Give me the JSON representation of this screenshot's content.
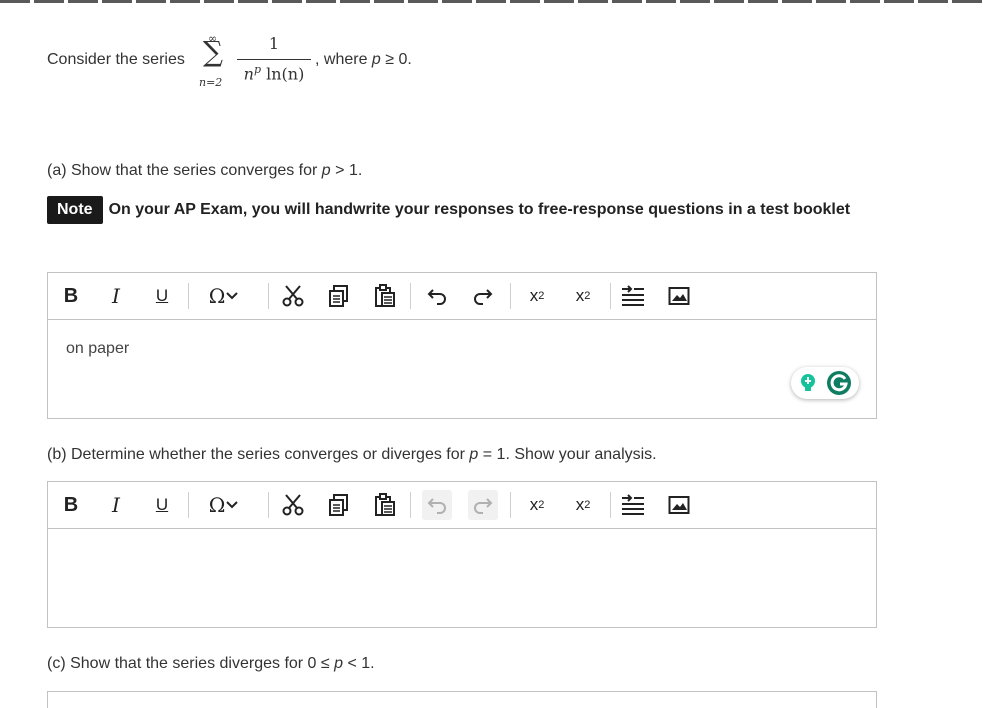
{
  "intro": {
    "lead": "Consider the series",
    "sum_upper": "∞",
    "sum_symbol": "∑",
    "sum_lower": "n=2",
    "numerator": "1",
    "denominator_np": "n",
    "denominator_p": "p",
    "denominator_ln": " ln(n)",
    "comma": ",",
    "where": " where ",
    "condition_var": "p",
    "condition_rest": " ≥ 0."
  },
  "part_a": {
    "text_pre": "(a) Show that the series converges for ",
    "var": "p",
    "text_post": " > 1."
  },
  "note": {
    "badge": "Note",
    "text": "On your AP Exam, you will handwrite your responses to free-response questions in a test booklet"
  },
  "editor_a": {
    "content": "on paper"
  },
  "part_b": {
    "text_pre": "(b) Determine whether the series converges or diverges for ",
    "var": "p",
    "text_post": " = 1. Show your analysis."
  },
  "editor_b": {
    "content": ""
  },
  "part_c": {
    "text_pre": "(c) Show that the series diverges for 0 ≤ ",
    "var": "p",
    "text_post": " < 1."
  },
  "toolbar": {
    "bold": "B",
    "italic": "I",
    "underline": "U",
    "omega": "Ω",
    "chevron": "⌄",
    "superscript_base": "x",
    "superscript_exp": "2",
    "subscript_base": "x",
    "subscript_exp": "2"
  },
  "icons": [
    "bold-icon",
    "italic-icon",
    "underline-icon",
    "special-characters-icon",
    "cut-icon",
    "copy-icon",
    "paste-icon",
    "undo-icon",
    "redo-icon",
    "superscript-icon",
    "subscript-icon",
    "insert-tab-icon",
    "insert-image-icon",
    "grammarly-icon"
  ],
  "colors": {
    "grammarly_green": "#15c39a",
    "grammarly_dark": "#0f7d62",
    "note_bg": "#1a1a1a"
  }
}
